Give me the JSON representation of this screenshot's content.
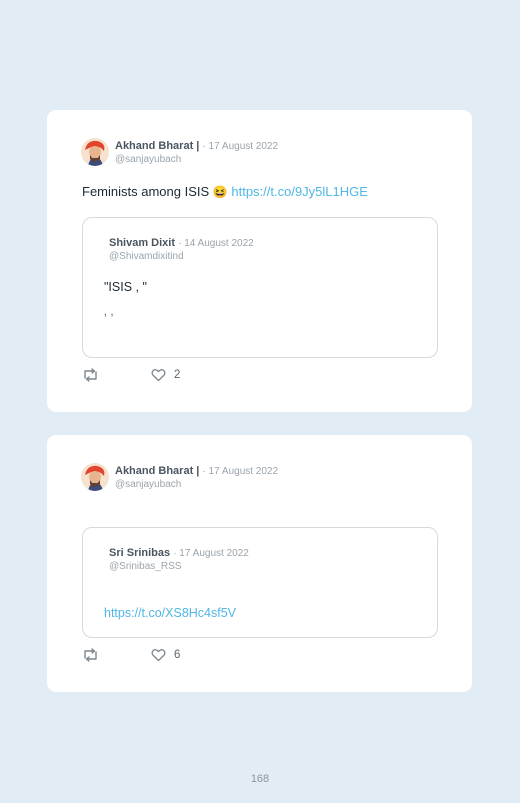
{
  "tweets": [
    {
      "author": {
        "name": "Akhand Bharat |",
        "date": "· 17 August 2022",
        "handle": "@sanjayubach"
      },
      "text": "Feminists among ISIS",
      "emoji": "😆",
      "link": "https://t.co/9Jy5lL1HGE",
      "quote": {
        "author": {
          "name": "Shivam Dixit",
          "date": "· 14 August 2022",
          "handle": "@Shivamdixitind"
        },
        "text": "\"ISIS , \"",
        "text2": "‚ ,"
      },
      "like_count": "2"
    },
    {
      "author": {
        "name": "Akhand Bharat |",
        "date": "· 17 August 2022",
        "handle": "@sanjayubach"
      },
      "quote": {
        "author": {
          "name": "Sri Srinibas",
          "date": "· 17 August 2022",
          "handle": "@Srinibas_RSS"
        },
        "link": "https://t.co/XS8Hc4sf5V"
      },
      "like_count": "6"
    }
  ],
  "page_number": "168"
}
